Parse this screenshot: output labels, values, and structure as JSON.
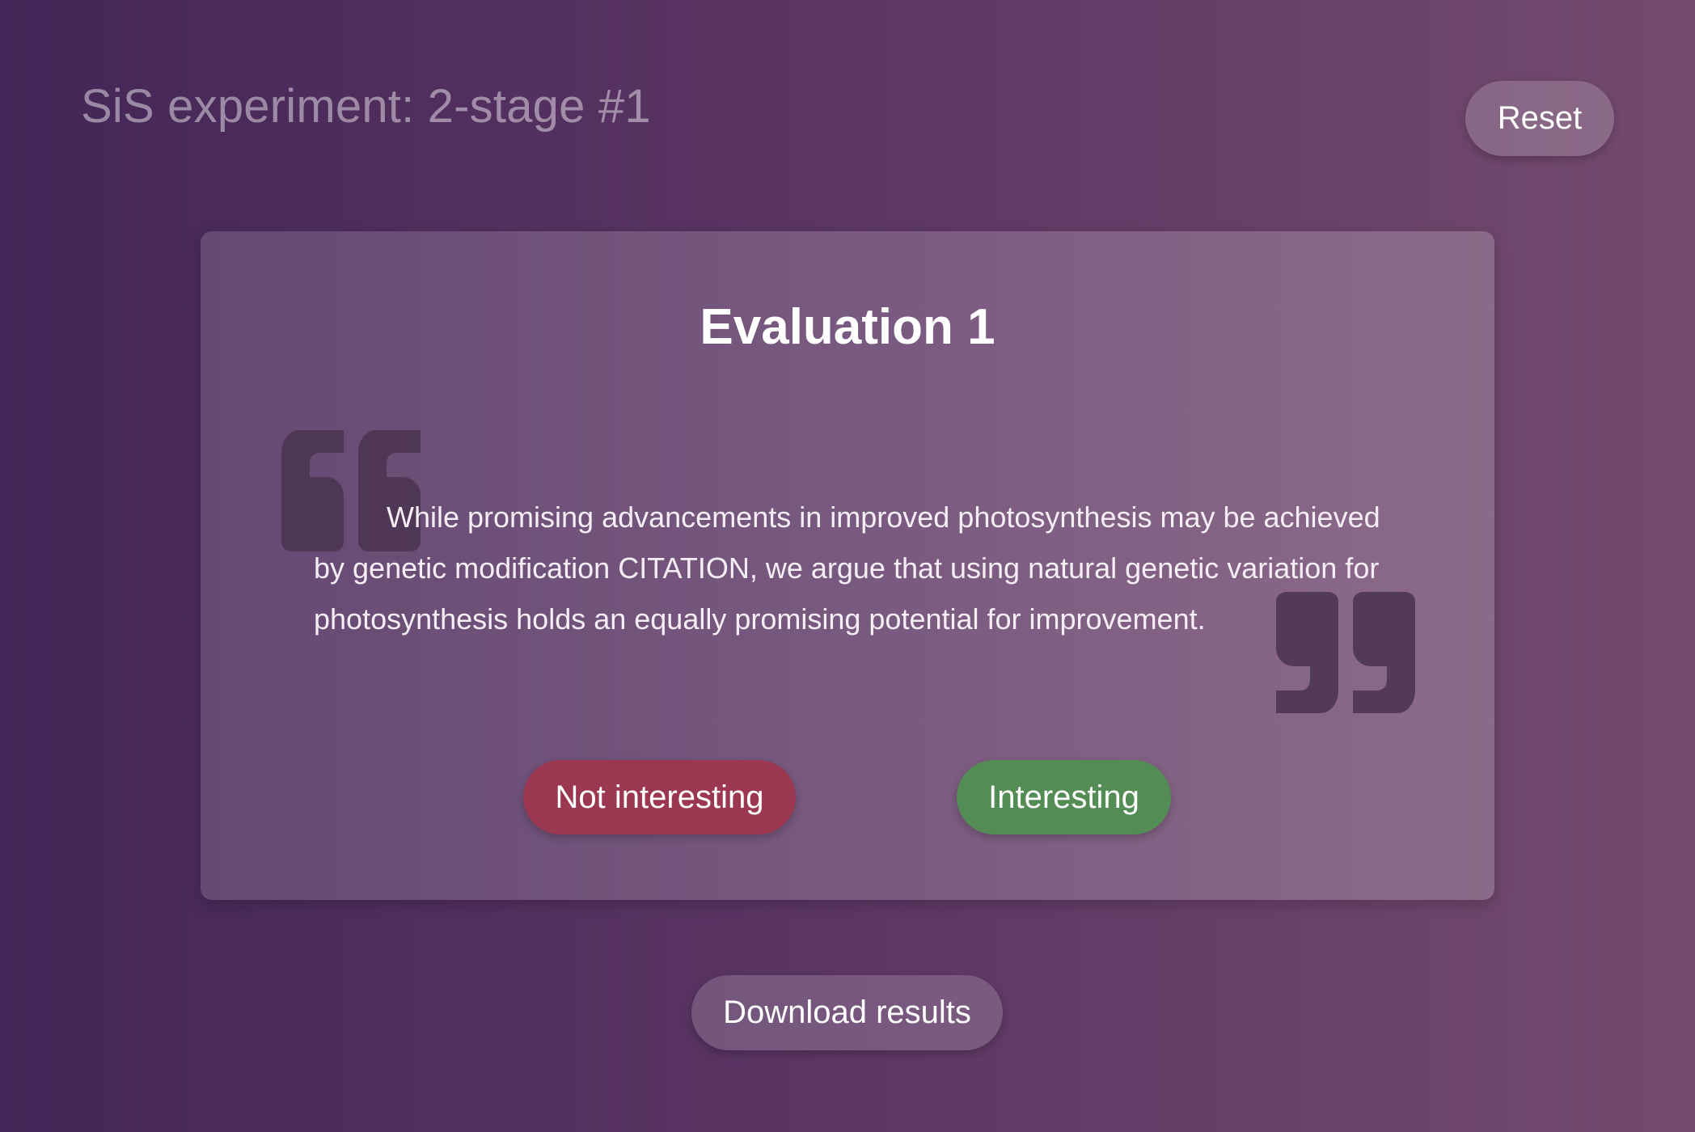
{
  "header": {
    "title": "SiS experiment: 2-stage #1",
    "reset_label": "Reset"
  },
  "card": {
    "title": "Evaluation 1",
    "quote_text": "While promising advancements in improved photosynthesis may be achieved by genetic modification CITATION, we argue that using natural genetic variation for photosynthesis holds an equally promising potential for improvement.",
    "not_interesting_label": "Not interesting",
    "interesting_label": "Interesting"
  },
  "footer": {
    "download_label": "Download results"
  },
  "icons": {
    "open_quote": "open-quote-icon",
    "close_quote": "close-quote-icon"
  },
  "colors": {
    "not_interesting": "#9b3751",
    "interesting": "#548c55",
    "quote_mark": "#4a3450"
  }
}
